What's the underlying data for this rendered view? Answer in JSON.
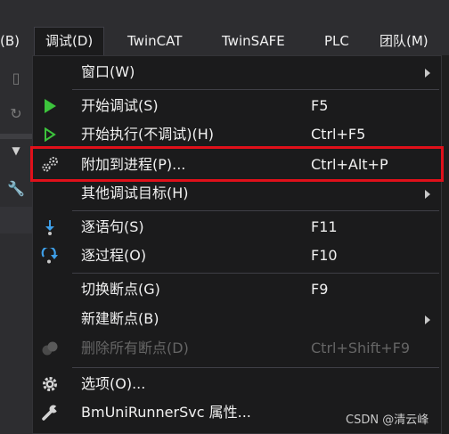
{
  "menubar": {
    "items": [
      {
        "label": "(B)"
      },
      {
        "label": "调试(D)"
      },
      {
        "label": "TwinCAT"
      },
      {
        "label": "TwinSAFE"
      },
      {
        "label": "PLC"
      },
      {
        "label": "团队(M)"
      }
    ]
  },
  "menu": {
    "items": [
      {
        "label": "窗口(W)",
        "shortcut": "",
        "icon": "none",
        "submenu": true
      },
      {
        "label": "开始调试(S)",
        "shortcut": "F5",
        "icon": "play-icon"
      },
      {
        "label": "开始执行(不调试)(H)",
        "shortcut": "Ctrl+F5",
        "icon": "play-outline-icon"
      },
      {
        "label": "附加到进程(P)...",
        "shortcut": "Ctrl+Alt+P",
        "icon": "gears-icon"
      },
      {
        "label": "其他调试目标(H)",
        "shortcut": "",
        "icon": "none",
        "submenu": true
      },
      {
        "label": "逐语句(S)",
        "shortcut": "F11",
        "icon": "step-into-icon"
      },
      {
        "label": "逐过程(O)",
        "shortcut": "F10",
        "icon": "step-over-icon"
      },
      {
        "label": "切换断点(G)",
        "shortcut": "F9",
        "icon": "none"
      },
      {
        "label": "新建断点(B)",
        "shortcut": "",
        "icon": "none",
        "submenu": true
      },
      {
        "label": "删除所有断点(D)",
        "shortcut": "Ctrl+Shift+F9",
        "icon": "delete-breakpoints-icon",
        "disabled": true
      },
      {
        "label": "选项(O)...",
        "shortcut": "",
        "icon": "gear-icon"
      },
      {
        "label": "BmUniRunnerSvc 属性...",
        "shortcut": "",
        "icon": "wrench-icon"
      }
    ]
  },
  "colors": {
    "accent_play": "#3cc43c",
    "step_blue": "#3e9fe8",
    "highlight_red": "#e0101a"
  },
  "watermark": "CSDN @清云峰"
}
